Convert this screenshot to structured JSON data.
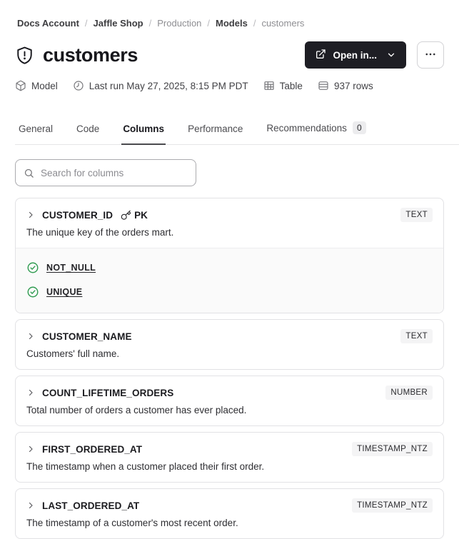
{
  "breadcrumb": {
    "separator": "/",
    "items": [
      {
        "label": "Docs Account"
      },
      {
        "label": "Jaffle Shop"
      },
      {
        "label": "Production"
      },
      {
        "label": "Models"
      },
      {
        "label": "customers"
      }
    ]
  },
  "header": {
    "title": "customers",
    "open_in_label": "Open in..."
  },
  "metadata": {
    "items": [
      {
        "icon": "cube-icon",
        "label": "Model"
      },
      {
        "icon": "clock-icon",
        "label": "Last run May 27, 2025, 8:15 PM PDT"
      },
      {
        "icon": "table-icon",
        "label": "Table"
      },
      {
        "icon": "rows-icon",
        "label": "937 rows"
      }
    ]
  },
  "tabs": [
    {
      "label": "General"
    },
    {
      "label": "Code"
    },
    {
      "label": "Columns",
      "active": true
    },
    {
      "label": "Performance"
    },
    {
      "label": "Recommendations",
      "badge": "0"
    }
  ],
  "search": {
    "placeholder": "Search for columns"
  },
  "columns": [
    {
      "name": "CUSTOMER_ID",
      "pk_label": "PK",
      "type": "TEXT",
      "description": "The unique key of the orders mart.",
      "constraints": [
        "NOT_NULL",
        "UNIQUE"
      ]
    },
    {
      "name": "CUSTOMER_NAME",
      "type": "TEXT",
      "description": "Customers' full name."
    },
    {
      "name": "COUNT_LIFETIME_ORDERS",
      "type": "NUMBER",
      "description": "Total number of orders a customer has ever placed."
    },
    {
      "name": "FIRST_ORDERED_AT",
      "type": "TIMESTAMP_NTZ",
      "description": "The timestamp when a customer placed their first order."
    },
    {
      "name": "LAST_ORDERED_AT",
      "type": "TIMESTAMP_NTZ",
      "description": "The timestamp of a customer's most recent order."
    }
  ],
  "colors": {
    "primary_button_bg": "#1e1e24",
    "success_green": "#319c52",
    "badge_bg": "#f4f4f5",
    "card_border": "#e2e2e5",
    "muted_text": "#8e8e92"
  }
}
